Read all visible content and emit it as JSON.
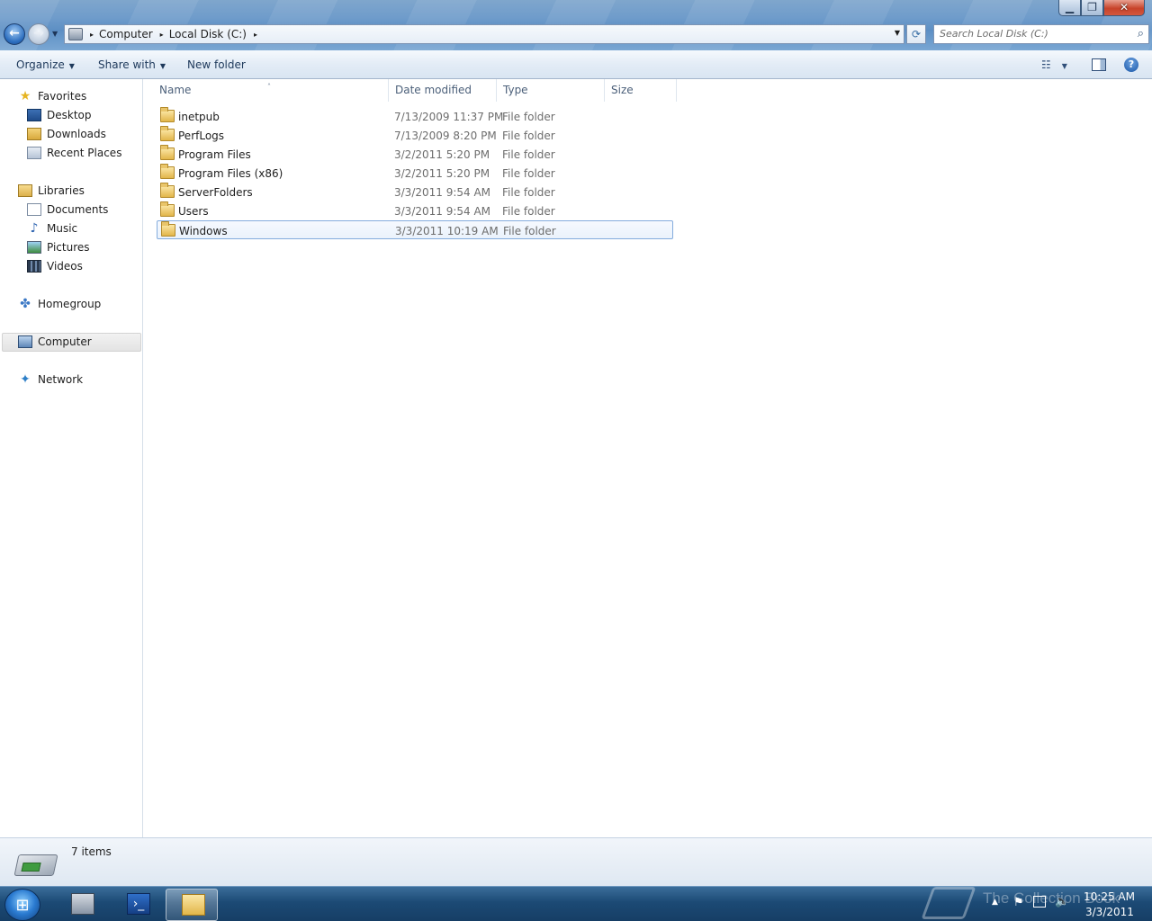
{
  "window": {
    "minimize_glyph": "▁",
    "maximize_glyph": "❐",
    "close_glyph": "✕"
  },
  "nav": {
    "back_glyph": "←",
    "forward_glyph": "→"
  },
  "address": {
    "crumbs": [
      "Computer",
      "Local Disk (C:)"
    ],
    "separator": "▸",
    "dropdown_glyph": "▼",
    "refresh_glyph": "⟳"
  },
  "search": {
    "placeholder": "Search Local Disk (C:)",
    "icon": "search-icon"
  },
  "toolbar": {
    "organize": "Organize",
    "share_with": "Share with",
    "new_folder": "New folder",
    "dropdown_glyph": "▼",
    "views_glyph": "☷",
    "help_glyph": "?"
  },
  "navpane": {
    "favorites": "Favorites",
    "desktop": "Desktop",
    "downloads": "Downloads",
    "recent_places": "Recent Places",
    "libraries": "Libraries",
    "documents": "Documents",
    "music": "Music",
    "pictures": "Pictures",
    "videos": "Videos",
    "homegroup": "Homegroup",
    "computer": "Computer",
    "network": "Network"
  },
  "columns": {
    "name": "Name",
    "date_modified": "Date modified",
    "type": "Type",
    "size": "Size",
    "sort_glyph": "˄"
  },
  "files": [
    {
      "name": "inetpub",
      "date": "7/13/2009 11:37 PM",
      "type": "File folder"
    },
    {
      "name": "PerfLogs",
      "date": "7/13/2009 8:20 PM",
      "type": "File folder"
    },
    {
      "name": "Program Files",
      "date": "3/2/2011 5:20 PM",
      "type": "File folder"
    },
    {
      "name": "Program Files (x86)",
      "date": "3/2/2011 5:20 PM",
      "type": "File folder"
    },
    {
      "name": "ServerFolders",
      "date": "3/3/2011 9:54 AM",
      "type": "File folder"
    },
    {
      "name": "Users",
      "date": "3/3/2011 9:54 AM",
      "type": "File folder"
    },
    {
      "name": "Windows",
      "date": "3/3/2011 10:19 AM",
      "type": "File folder"
    }
  ],
  "selected_file": "Windows",
  "status": {
    "item_count": "7 items"
  },
  "taskbar": {
    "watermark": "The Collection Book",
    "time": "10:25 AM",
    "date": "3/3/2011"
  }
}
